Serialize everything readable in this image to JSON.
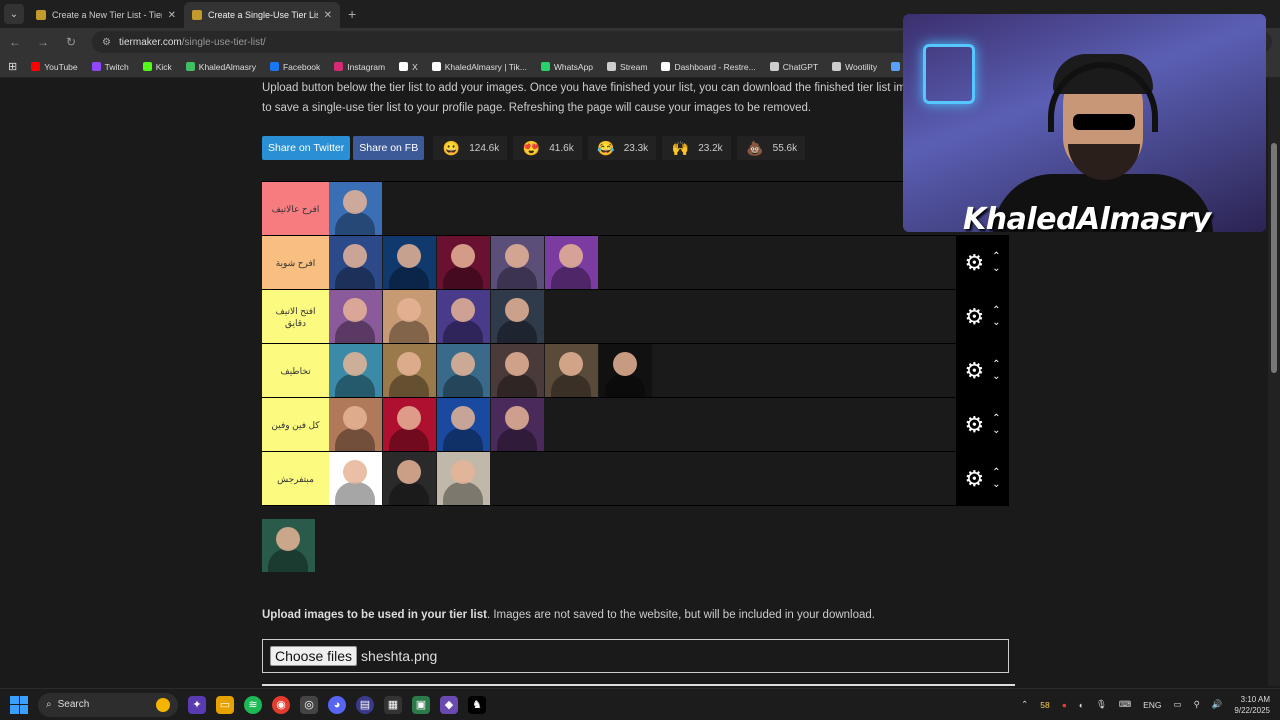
{
  "browser": {
    "tabs": [
      {
        "title": "Create a New Tier List - TierMa",
        "active": false
      },
      {
        "title": "Create a Single-Use Tier List (P",
        "active": true
      }
    ],
    "url_domain": "tiermaker.com",
    "url_path": "/single-use-tier-list/",
    "bookmarks": [
      {
        "label": "YouTube",
        "color": "#ff0000"
      },
      {
        "label": "Twitch",
        "color": "#9146ff"
      },
      {
        "label": "Kick",
        "color": "#53fc18"
      },
      {
        "label": "KhaledAlmasry",
        "color": "#3fbf5f"
      },
      {
        "label": "Facebook",
        "color": "#1877f2"
      },
      {
        "label": "Instagram",
        "color": "#d62976"
      },
      {
        "label": "X",
        "color": "#ffffff"
      },
      {
        "label": "KhaledAlmasry | Tik...",
        "color": "#ffffff"
      },
      {
        "label": "WhatsApp",
        "color": "#25d366"
      },
      {
        "label": "Stream",
        "color": "#cccccc"
      },
      {
        "label": "Dashboard - Restre...",
        "color": "#ffffff"
      },
      {
        "label": "ChatGPT",
        "color": "#cccccc"
      },
      {
        "label": "Wootility",
        "color": "#cccccc"
      },
      {
        "label": "KhaledAlma",
        "color": "#5aa0ff"
      }
    ]
  },
  "page": {
    "intro_line1": "Upload button below the tier list to add your images. Once you have finished your list, you can download the finished tier list ima",
    "intro_line2": "to save a single-use tier list to your profile page. Refreshing the page will cause your images to be removed.",
    "share_twitter": "Share on Twitter",
    "share_fb": "Share on FB",
    "reactions": [
      {
        "emoji": "😀",
        "count": "124.6k"
      },
      {
        "emoji": "😍",
        "count": "41.6k"
      },
      {
        "emoji": "😂",
        "count": "23.3k"
      },
      {
        "emoji": "🙌",
        "count": "23.2k"
      },
      {
        "emoji": "💩",
        "count": "55.6k"
      }
    ],
    "tiers": [
      {
        "label": "افرح عالاتيف",
        "color": "#f77c80",
        "items": [
          "#3b6fb5"
        ],
        "controls": false
      },
      {
        "label": "افرح شوية",
        "color": "#f8bf80",
        "items": [
          "#2c4a8a",
          "#103a6e",
          "#6a1030",
          "#5b4f7a",
          "#7a3ca0"
        ],
        "controls": true
      },
      {
        "label": "افتح الاتيف دقايق",
        "color": "#fcfb7f",
        "items": [
          "#8a5a9a",
          "#c69a72",
          "#4a3a8a",
          "#2f3a4a"
        ],
        "controls": true
      },
      {
        "label": "تخاطيف",
        "color": "#fcfb7f",
        "items": [
          "#3a8aa8",
          "#9a7a4a",
          "#3a6a8a",
          "#4a3a3a",
          "#5a4a3a",
          "#111111"
        ],
        "controls": true
      },
      {
        "label": "كل فين وفين",
        "color": "#fcfb7f",
        "items": [
          "#b07a5a",
          "#b01030",
          "#1a4aa0",
          "#4a2a5a"
        ],
        "controls": true
      },
      {
        "label": "مبتفرجش",
        "color": "#fcfb7f",
        "items": [
          "#ffffff",
          "#2a2a2a",
          "#c0b8a8"
        ],
        "controls": true
      }
    ],
    "pool_items": [
      "#2a5a4a"
    ],
    "upload_bold": "Upload images to be used in your tier list",
    "upload_rest": ". Images are not saved to the website, but will be included in your download.",
    "file_button": "Choose files",
    "file_name": "sheshta.png"
  },
  "overlay": {
    "streamer_name": "KhaledAlmasry"
  },
  "taskbar": {
    "search_label": "Search",
    "tray_temp": "58",
    "lang": "ENG",
    "time": "3:10 AM",
    "date": "9/22/2025"
  }
}
